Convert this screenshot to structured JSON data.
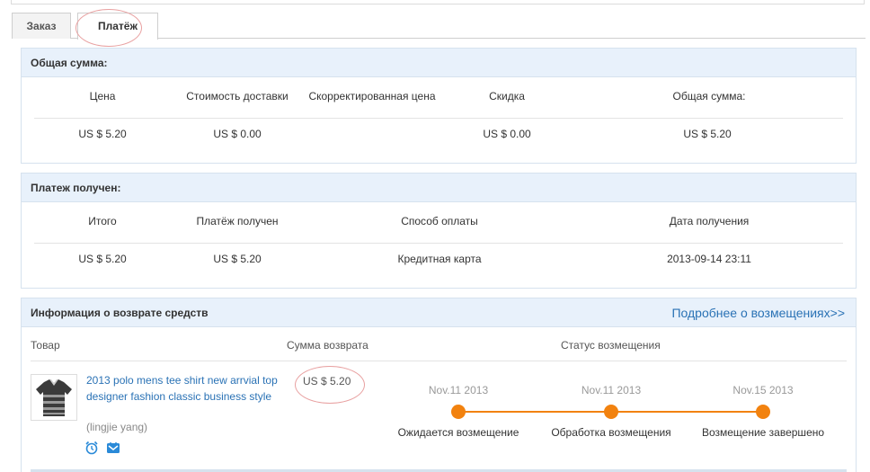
{
  "tabs": [
    {
      "label": "Заказ"
    },
    {
      "label": "Платёж"
    }
  ],
  "total": {
    "title": "Общая сумма:",
    "headers": [
      "Цена",
      "Стоимость доставки",
      "Скорректированная цена",
      "Скидка",
      "Общая сумма:"
    ],
    "values": [
      "US $ 5.20",
      "US $ 0.00",
      "",
      "US $ 0.00",
      "US $ 5.20"
    ]
  },
  "payment": {
    "title": "Платеж получен:",
    "headers": [
      "Итого",
      "Платёж получен",
      "Способ оплаты",
      "Дата получения"
    ],
    "values": [
      "US $ 5.20",
      "US $ 5.20",
      "Кредитная карта",
      "2013-09-14 23:11"
    ]
  },
  "refund": {
    "title": "Информация о возврате средств",
    "more_link": "Подробнее о возмещениях>>",
    "col_product": "Товар",
    "col_amount": "Сумма возврата",
    "col_status": "Статус возмещения",
    "product_title": "2013 polo mens tee shirt new arrvial top designer fashion classic business style",
    "seller": "(lingjie yang)",
    "amount": "US $ 5.20",
    "steps": [
      {
        "date": "Nov.11 2013",
        "label": "Ожидается возмещение"
      },
      {
        "date": "Nov.11 2013",
        "label": "Обработка возмещения"
      },
      {
        "date": "Nov.15 2013",
        "label": "Возмещение завершено"
      }
    ],
    "icons": [
      "alarm-clock-icon",
      "message-icon"
    ],
    "accent": "#f2820f"
  }
}
